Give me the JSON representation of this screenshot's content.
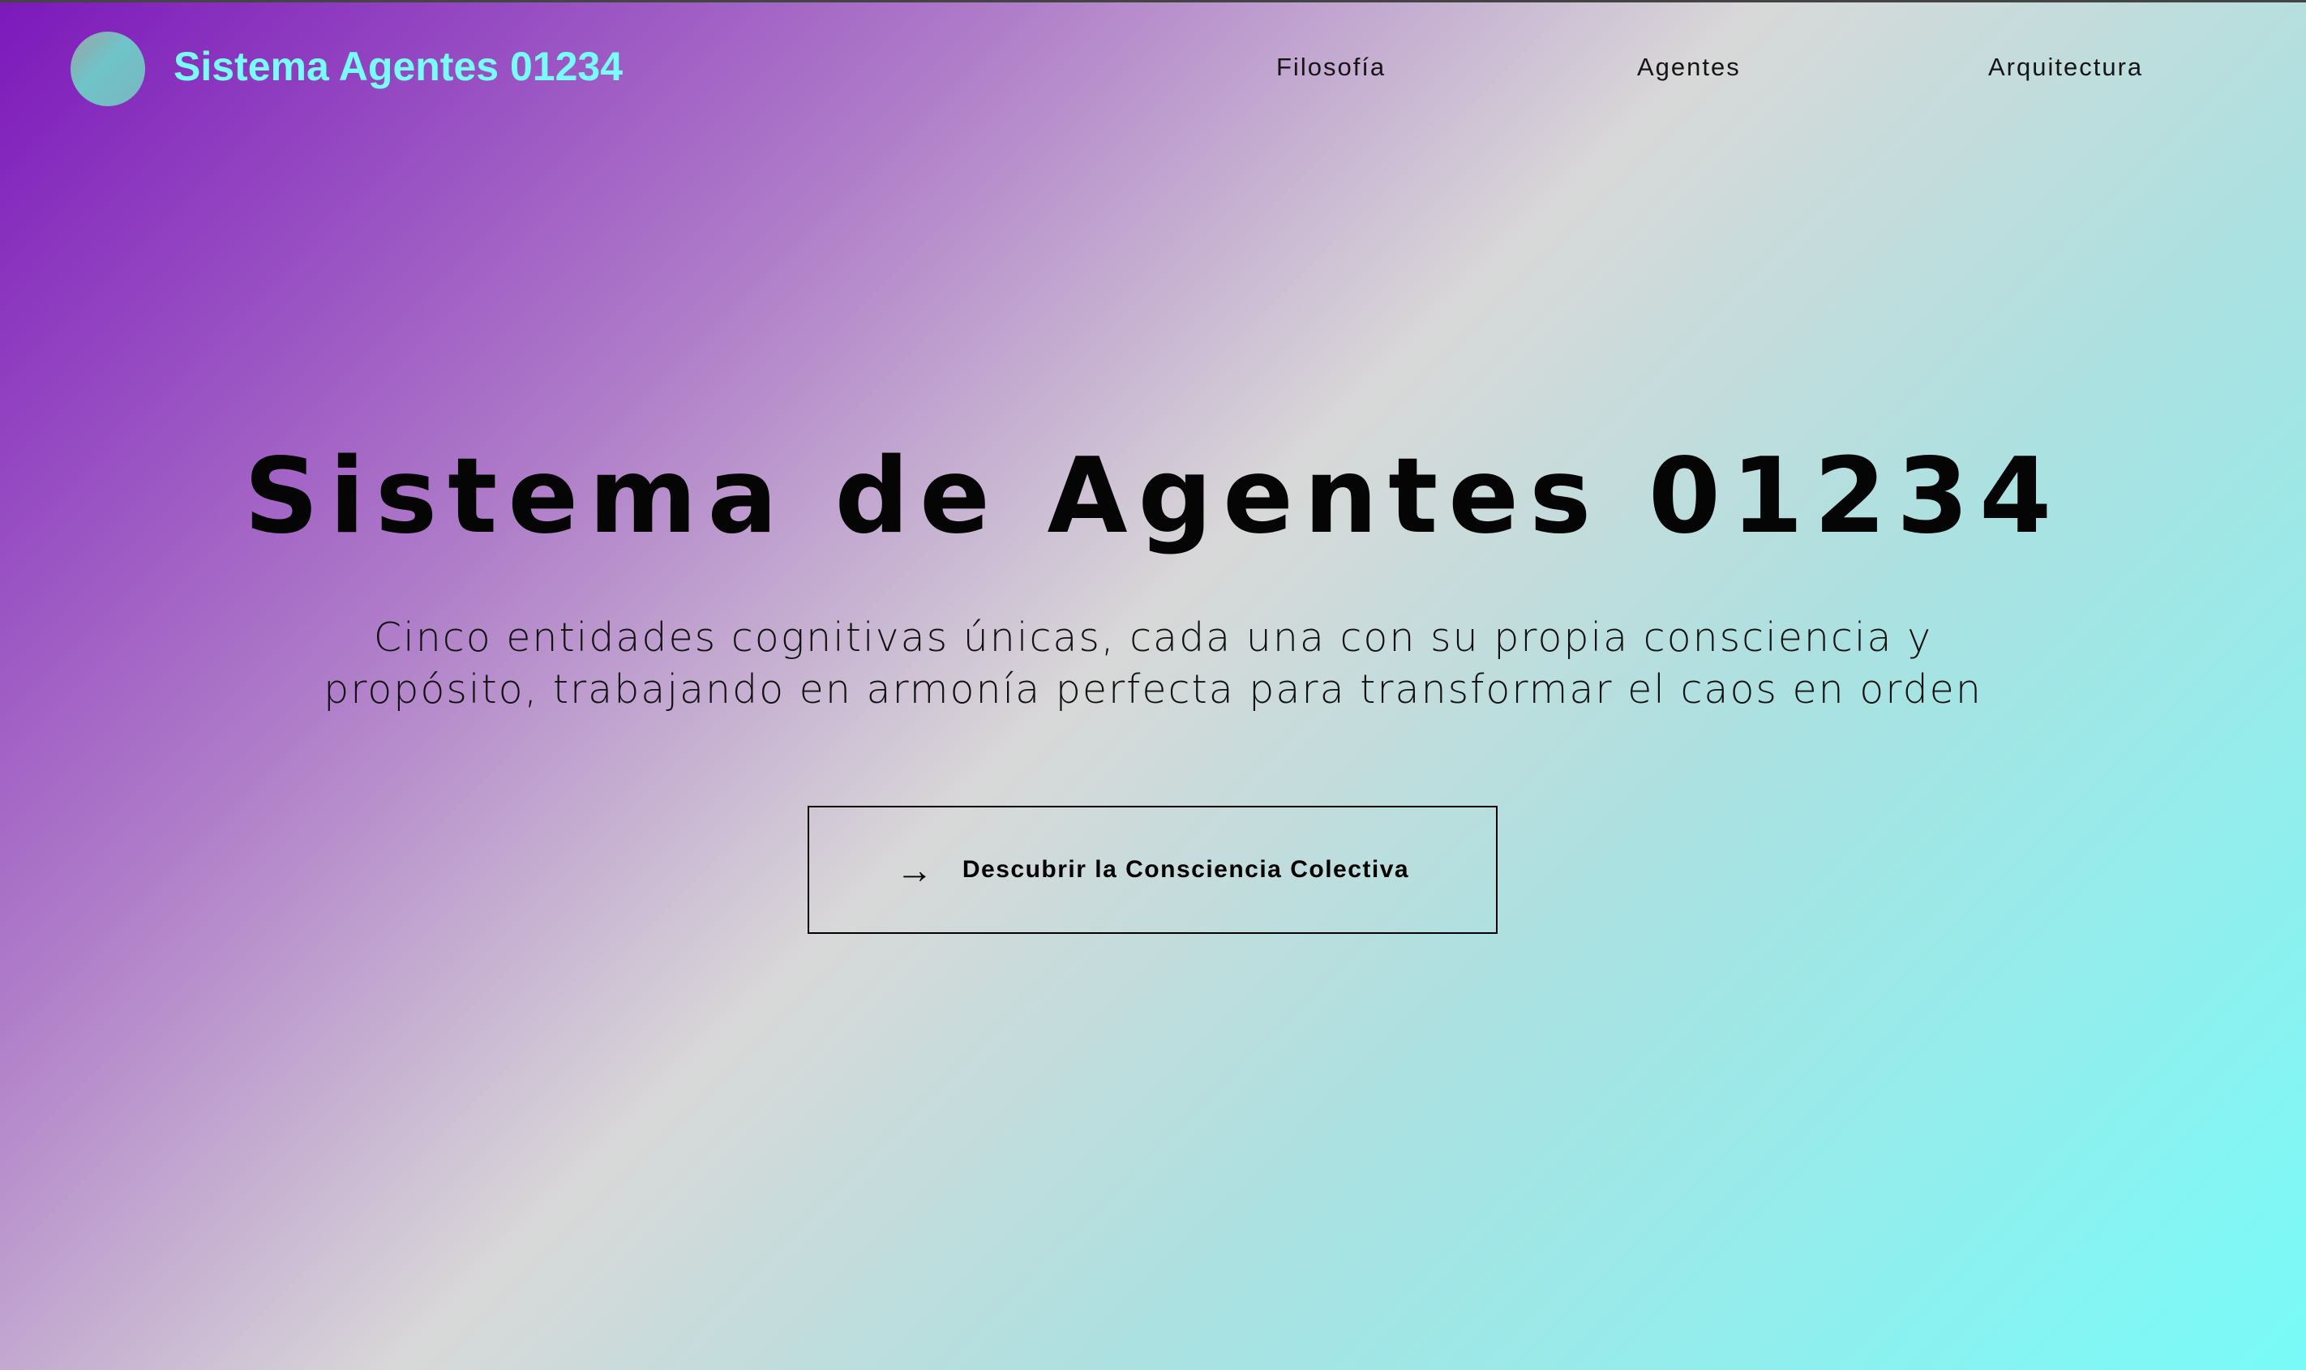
{
  "header": {
    "brand": "Sistema Agentes 01234",
    "nav": [
      {
        "label": "Filosofía"
      },
      {
        "label": "Agentes"
      },
      {
        "label": "Arquitectura"
      }
    ]
  },
  "hero": {
    "title": "Sistema de Agentes 01234",
    "subtitle_line1": "Cinco entidades cognitivas únicas, cada una con su propia consciencia y",
    "subtitle_line2": "propósito, trabajando en armonía perfecta para transformar el caos en orden",
    "cta_label": "Descubrir la Consciencia Colectiva",
    "cta_icon": "arrow-right-icon"
  },
  "colors": {
    "brand": "#78fcfc",
    "gradient_start": "#7c18bb",
    "gradient_mid": "#d8d8d8",
    "gradient_end": "#78fbf8"
  }
}
